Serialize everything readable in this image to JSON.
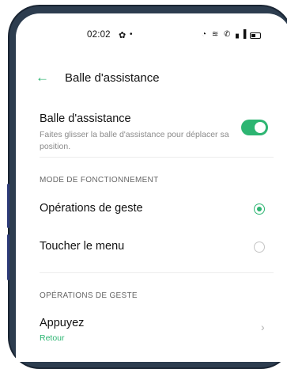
{
  "status_bar": {
    "time": "02:02",
    "settings_icon": "gear-icon",
    "dot": "•",
    "icons": [
      "data-saver-icon",
      "wifi-icon",
      "call-icon",
      "signal-icon",
      "battery-icon"
    ]
  },
  "header": {
    "back_icon": "back-arrow-icon",
    "title": "Balle d'assistance"
  },
  "assist_ball": {
    "title": "Balle d'assistance",
    "description": "Faites glisser la balle d'assistance pour déplacer sa position.",
    "enabled": true
  },
  "mode_section": {
    "header": "MODE DE FONCTIONNEMENT",
    "options": [
      {
        "label": "Opérations de geste",
        "selected": true
      },
      {
        "label": "Toucher le menu",
        "selected": false
      }
    ]
  },
  "gesture_section": {
    "header": "OPÉRATIONS DE GESTE",
    "items": [
      {
        "label": "Appuyez",
        "value": "Retour"
      }
    ]
  },
  "colors": {
    "accent": "#2db572",
    "frame": "#1a2533",
    "side_button": "#2c3a78"
  }
}
